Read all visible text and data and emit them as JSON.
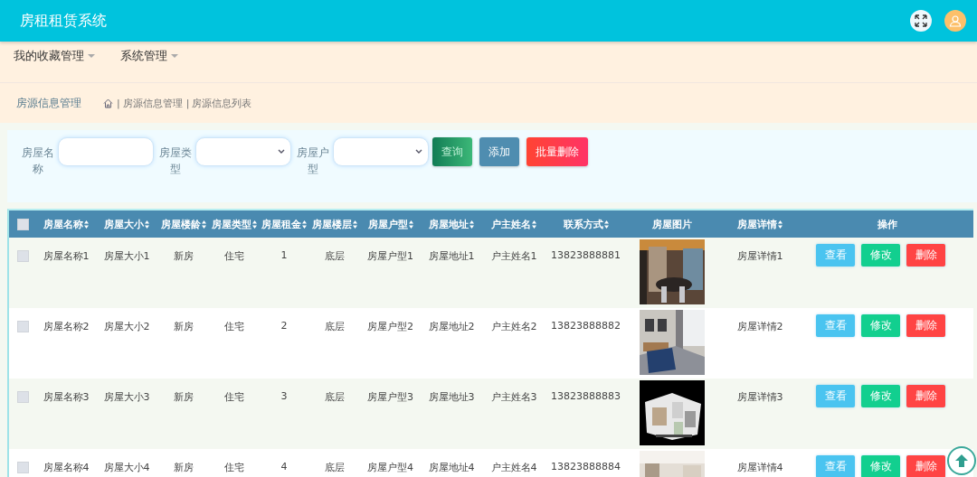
{
  "header": {
    "title": "房租租赁系统"
  },
  "nav": {
    "items": [
      {
        "label": "我的收藏管理"
      },
      {
        "label": "系统管理"
      }
    ]
  },
  "breadcrumb": {
    "section": "房源信息管理",
    "separator": "|",
    "path": [
      "房源信息管理",
      "房源信息列表"
    ]
  },
  "search": {
    "fields": [
      {
        "kind": "input",
        "label": "房屋名称"
      },
      {
        "kind": "select",
        "label": "房屋类型"
      },
      {
        "kind": "select",
        "label": "房屋户型"
      }
    ],
    "buttons": [
      {
        "kind": "query",
        "label": "查询"
      },
      {
        "kind": "add",
        "label": "添加"
      },
      {
        "kind": "batch-delete",
        "label": "批量删除"
      }
    ]
  },
  "table": {
    "select_all": {
      "checked": false
    },
    "columns": [
      {
        "label": "房屋名称",
        "sortable": true
      },
      {
        "label": "房屋大小",
        "sortable": true
      },
      {
        "label": "房屋楼龄",
        "sortable": true
      },
      {
        "label": "房屋类型",
        "sortable": true
      },
      {
        "label": "房屋租金",
        "sortable": true
      },
      {
        "label": "房屋楼层",
        "sortable": true
      },
      {
        "label": "房屋户型",
        "sortable": true
      },
      {
        "label": "房屋地址",
        "sortable": true
      },
      {
        "label": "户主姓名",
        "sortable": true
      },
      {
        "label": "联系方式",
        "sortable": true
      },
      {
        "label": "房屋图片",
        "sortable": false
      },
      {
        "label": "房屋详情",
        "sortable": true
      },
      {
        "label": "操作",
        "sortable": false
      }
    ],
    "rows": [
      {
        "checked": false,
        "cells": [
          "房屋名称1",
          "房屋大小1",
          "新房",
          "住宅",
          "1",
          "底层",
          "房屋户型1",
          "房屋地址1",
          "户主姓名1",
          "13823888881"
        ],
        "image": {
          "kind": "picture"
        },
        "detail": "房屋详情1",
        "actions": [
          {
            "kind": "view",
            "label": "查看"
          },
          {
            "kind": "edit",
            "label": "修改"
          },
          {
            "kind": "delete",
            "label": "删除"
          }
        ]
      },
      {
        "checked": false,
        "cells": [
          "房屋名称2",
          "房屋大小2",
          "新房",
          "住宅",
          "2",
          "底层",
          "房屋户型2",
          "房屋地址2",
          "户主姓名2",
          "13823888882"
        ],
        "image": {
          "kind": "picture"
        },
        "detail": "房屋详情2",
        "actions": [
          {
            "kind": "view",
            "label": "查看"
          },
          {
            "kind": "edit",
            "label": "修改"
          },
          {
            "kind": "delete",
            "label": "删除"
          }
        ]
      },
      {
        "checked": false,
        "cells": [
          "房屋名称3",
          "房屋大小3",
          "新房",
          "住宅",
          "3",
          "底层",
          "房屋户型3",
          "房屋地址3",
          "户主姓名3",
          "13823888883"
        ],
        "image": {
          "kind": "picture"
        },
        "detail": "房屋详情3",
        "actions": [
          {
            "kind": "view",
            "label": "查看"
          },
          {
            "kind": "edit",
            "label": "修改"
          },
          {
            "kind": "delete",
            "label": "删除"
          }
        ]
      },
      {
        "checked": false,
        "cells": [
          "房屋名称4",
          "房屋大小4",
          "新房",
          "住宅",
          "4",
          "底层",
          "房屋户型4",
          "房屋地址4",
          "户主姓名4",
          "13823888884"
        ],
        "image": {
          "kind": "picture"
        },
        "detail": "房屋详情4",
        "actions": [
          {
            "kind": "view",
            "label": "查看"
          },
          {
            "kind": "edit",
            "label": "修改"
          },
          {
            "kind": "delete",
            "label": "删除"
          }
        ]
      }
    ]
  }
}
